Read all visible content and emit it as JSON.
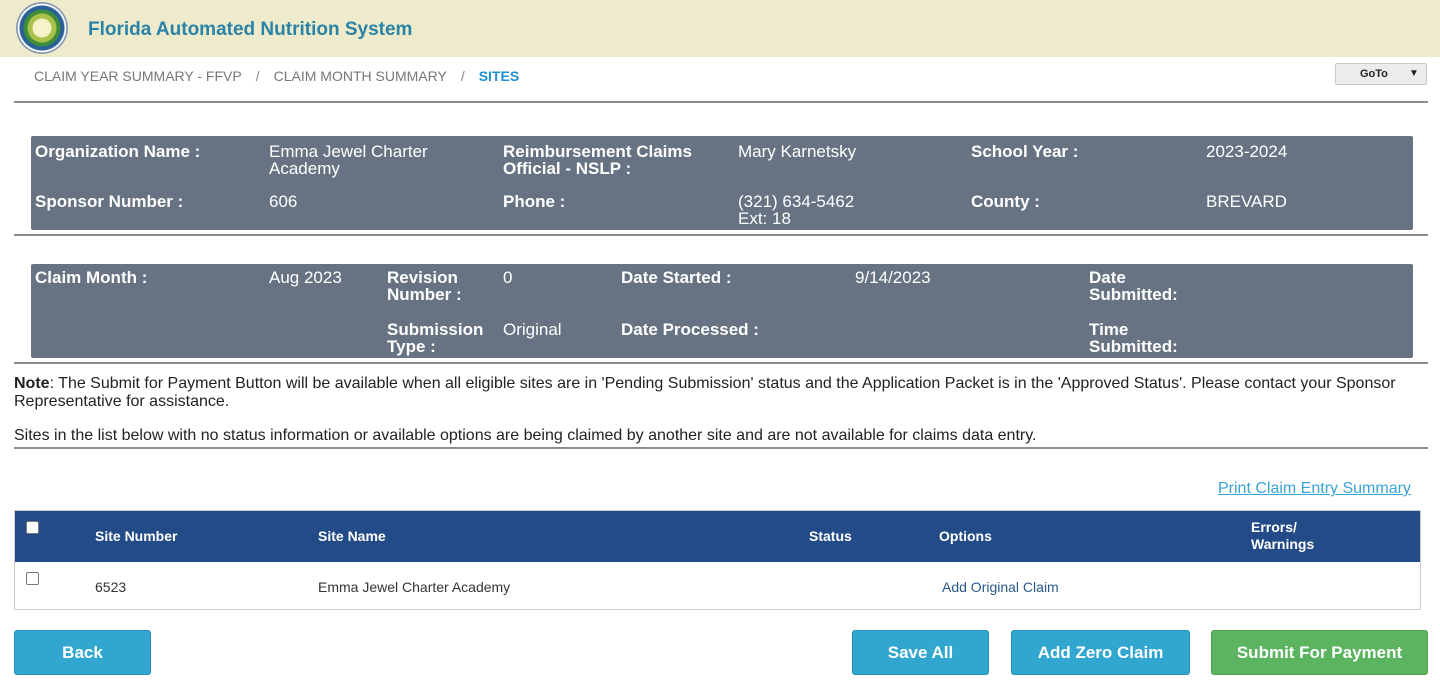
{
  "header": {
    "title": "Florida Automated Nutrition System"
  },
  "breadcrumb": {
    "items": [
      "CLAIM YEAR SUMMARY - FFVP",
      "CLAIM MONTH SUMMARY",
      "SITES"
    ],
    "separator": "/"
  },
  "goto": {
    "label": "GoTo",
    "caret": "▼"
  },
  "org_panel": {
    "org_name_label": "Organization Name :",
    "org_name_value": "Emma Jewel Charter Academy",
    "official_label": "Reimbursement Claims Official - NSLP :",
    "official_value": "Mary Karnetsky",
    "school_year_label": "School Year :",
    "school_year_value": "2023-2024",
    "sponsor_label": "Sponsor Number :",
    "sponsor_value": "606",
    "phone_label": "Phone :",
    "phone_value": "(321) 634-5462",
    "phone_ext": "Ext: 18",
    "county_label": "County :",
    "county_value": "BREVARD"
  },
  "claim_panel": {
    "claim_month_label": "Claim Month :",
    "claim_month_value": "Aug 2023",
    "revision_label": "Revision Number :",
    "revision_value": "0",
    "submission_type_label": "Submission Type :",
    "submission_type_value": "Original",
    "date_started_label": "Date Started :",
    "date_started_value": "9/14/2023",
    "date_processed_label": "Date Processed :",
    "date_submitted_label": "Date Submitted:",
    "time_submitted_label": "Time Submitted:"
  },
  "notes": {
    "note_prefix": "Note",
    "note_text": ": The Submit for Payment Button will be available when all eligible sites are in 'Pending Submission' status and the Application Packet is in the 'Approved Status'. Please contact your Sponsor Representative for assistance.",
    "sites_text": "Sites in the list below with no status information or available options are being claimed by another site and are not available for claims data entry."
  },
  "print_link": "Print Claim Entry Summary",
  "table": {
    "headers": {
      "site_number": "Site Number",
      "site_name": "Site Name",
      "status": "Status",
      "options": "Options",
      "errors": "Errors/ Warnings"
    },
    "rows": [
      {
        "site_number": "6523",
        "site_name": "Emma Jewel Charter Academy",
        "status": "",
        "options": "Add Original Claim",
        "errors": ""
      }
    ]
  },
  "buttons": {
    "back": "Back",
    "save_all": "Save All",
    "add_zero_claim": "Add Zero Claim",
    "submit_for_payment": "Submit For Payment"
  },
  "colors": {
    "header_bg": "#eeebcc",
    "title": "#2a83a6",
    "panel_bg": "#677383",
    "table_header_bg": "#234b87",
    "button_blue": "#31a6cf",
    "button_green": "#5cb461",
    "active_crumb": "#1f8fcf"
  }
}
